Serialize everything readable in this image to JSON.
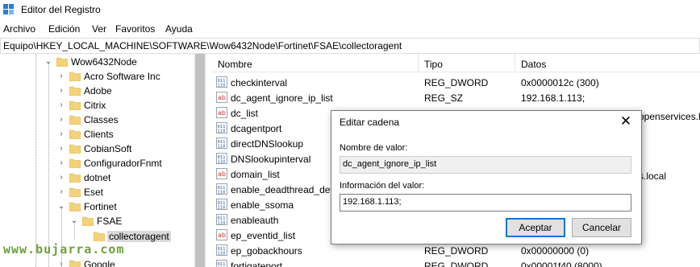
{
  "window": {
    "title": "Editor del Registro",
    "icon": "registry-editor-icon"
  },
  "menu": [
    "Archivo",
    "Edición",
    "Ver",
    "Favoritos",
    "Ayuda"
  ],
  "address": "Equipo\\HKEY_LOCAL_MACHINE\\SOFTWARE\\Wow6432Node\\Fortinet\\FSAE\\collectoragent",
  "tree": {
    "items": [
      {
        "label": "Wow6432Node",
        "expander": "⌄"
      },
      {
        "label": "Acro Software Inc",
        "expander": "›"
      },
      {
        "label": "Adobe",
        "expander": "›"
      },
      {
        "label": "Citrix",
        "expander": "›"
      },
      {
        "label": "Classes",
        "expander": "›"
      },
      {
        "label": "Clients",
        "expander": "›"
      },
      {
        "label": "CobianSoft",
        "expander": "›"
      },
      {
        "label": "ConfiguradorFnmt",
        "expander": "›"
      },
      {
        "label": "dotnet",
        "expander": "›"
      },
      {
        "label": "Eset",
        "expander": "›"
      },
      {
        "label": "Fortinet",
        "expander": "⌄"
      },
      {
        "label": "FSAE",
        "expander": "⌄"
      },
      {
        "label": "collectoragent",
        "expander": ""
      },
      {
        "label": "Google",
        "expander": "›"
      }
    ]
  },
  "list": {
    "headers": {
      "name": "Nombre",
      "type": "Tipo",
      "data": "Datos"
    },
    "rows": [
      {
        "name": "checkinterval",
        "type": "REG_DWORD",
        "data": "0x0000012c (300)",
        "icon": "dword"
      },
      {
        "name": "dc_agent_ignore_ip_list",
        "type": "REG_SZ",
        "data": "192.168.1.113;",
        "icon": "string"
      },
      {
        "name": "dc_list",
        "type": "",
        "data": "",
        "icon": "string"
      },
      {
        "name": "dcagentport",
        "type": "",
        "data": "",
        "icon": "dword"
      },
      {
        "name": "directDNSlookup",
        "type": "",
        "data": "",
        "icon": "dword"
      },
      {
        "name": "DNSlookupinterval",
        "type": "",
        "data": "",
        "icon": "dword"
      },
      {
        "name": "domain_list",
        "type": "",
        "data": "",
        "icon": "string"
      },
      {
        "name": "enable_deadthread_dete",
        "type": "",
        "data": "",
        "icon": "dword"
      },
      {
        "name": "enable_ssoma",
        "type": "",
        "data": "",
        "icon": "dword"
      },
      {
        "name": "enableauth",
        "type": "",
        "data": "",
        "icon": "dword"
      },
      {
        "name": "ep_eventid_list",
        "type": "",
        "data": "",
        "icon": "string"
      },
      {
        "name": "ep_gobackhours",
        "type": "REG_DWORD",
        "data": "0x00000000 (0)",
        "icon": "dword"
      },
      {
        "name": "fortigateport",
        "type": "REG_DWORD",
        "data": "0x00001f40 (8000)",
        "icon": "dword"
      }
    ],
    "peeking_text": {
      "row3": "openservices.lo",
      "row7": "s.local"
    }
  },
  "dialog": {
    "title": "Editar cadena",
    "value_name_label": "Nombre de valor:",
    "value_name": "dc_agent_ignore_ip_list",
    "value_data_label": "Información del valor:",
    "value_data": "192.168.1.113;",
    "ok_label": "Aceptar",
    "cancel_label": "Cancelar",
    "close_glyph": "✕"
  },
  "watermark": "www.bujarra.com",
  "colors": {
    "folder": "#f4d27a",
    "folder_dark": "#dcb247",
    "selection": "#d9d9d9",
    "accent": "#0078d7"
  }
}
